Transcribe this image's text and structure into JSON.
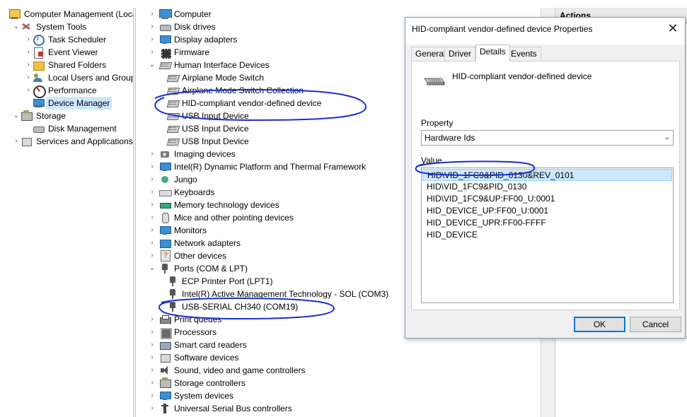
{
  "left_tree": [
    {
      "label": "Computer Management (Local",
      "level": 0,
      "chevron": "",
      "icon": "computer-management-icon",
      "selected": false
    },
    {
      "label": "System Tools",
      "level": 1,
      "chevron": "v",
      "icon": "tools-icon",
      "selected": false
    },
    {
      "label": "Task Scheduler",
      "level": 2,
      "chevron": ">",
      "icon": "clock-icon",
      "selected": false
    },
    {
      "label": "Event Viewer",
      "level": 2,
      "chevron": ">",
      "icon": "event-log-icon",
      "selected": false
    },
    {
      "label": "Shared Folders",
      "level": 2,
      "chevron": ">",
      "icon": "folder-icon",
      "selected": false
    },
    {
      "label": "Local Users and Groups",
      "level": 2,
      "chevron": ">",
      "icon": "users-icon",
      "selected": false
    },
    {
      "label": "Performance",
      "level": 2,
      "chevron": ">",
      "icon": "performance-icon",
      "selected": false
    },
    {
      "label": "Device Manager",
      "level": 2,
      "chevron": "",
      "icon": "device-manager-icon",
      "selected": true
    },
    {
      "label": "Storage",
      "level": 1,
      "chevron": "v",
      "icon": "storage-icon",
      "selected": false
    },
    {
      "label": "Disk Management",
      "level": 2,
      "chevron": "",
      "icon": "disk-icon",
      "selected": false
    },
    {
      "label": "Services and Applications",
      "level": 1,
      "chevron": ">",
      "icon": "services-icon",
      "selected": false
    }
  ],
  "device_tree": [
    {
      "label": "Computer",
      "level": 0,
      "chevron": ">",
      "icon": "computer-icon"
    },
    {
      "label": "Disk drives",
      "level": 0,
      "chevron": ">",
      "icon": "disk-icon"
    },
    {
      "label": "Display adapters",
      "level": 0,
      "chevron": ">",
      "icon": "monitor-icon"
    },
    {
      "label": "Firmware",
      "level": 0,
      "chevron": ">",
      "icon": "chip-icon"
    },
    {
      "label": "Human Interface Devices",
      "level": 0,
      "chevron": "v",
      "icon": "hid-icon"
    },
    {
      "label": "Airplane Mode Switch",
      "level": 1,
      "chevron": "",
      "icon": "hid-icon"
    },
    {
      "label": "Airplane Mode Switch Collection",
      "level": 1,
      "chevron": "",
      "icon": "hid-icon"
    },
    {
      "label": "HID-compliant vendor-defined device",
      "level": 1,
      "chevron": "",
      "icon": "hid-icon"
    },
    {
      "label": "USB Input Device",
      "level": 1,
      "chevron": "",
      "icon": "hid-icon"
    },
    {
      "label": "USB Input Device",
      "level": 1,
      "chevron": "",
      "icon": "hid-icon"
    },
    {
      "label": "USB Input Device",
      "level": 1,
      "chevron": "",
      "icon": "hid-icon"
    },
    {
      "label": "Imaging devices",
      "level": 0,
      "chevron": ">",
      "icon": "camera-icon"
    },
    {
      "label": "Intel(R) Dynamic Platform and Thermal Framework",
      "level": 0,
      "chevron": ">",
      "icon": "monitor-icon"
    },
    {
      "label": "Jungo",
      "level": 0,
      "chevron": ">",
      "icon": "jungo-icon"
    },
    {
      "label": "Keyboards",
      "level": 0,
      "chevron": ">",
      "icon": "keyboard-icon"
    },
    {
      "label": "Memory technology devices",
      "level": 0,
      "chevron": ">",
      "icon": "memory-icon"
    },
    {
      "label": "Mice and other pointing devices",
      "level": 0,
      "chevron": ">",
      "icon": "mouse-icon"
    },
    {
      "label": "Monitors",
      "level": 0,
      "chevron": ">",
      "icon": "monitor-icon"
    },
    {
      "label": "Network adapters",
      "level": 0,
      "chevron": ">",
      "icon": "network-icon"
    },
    {
      "label": "Other devices",
      "level": 0,
      "chevron": ">",
      "icon": "other-device-icon"
    },
    {
      "label": "Ports (COM & LPT)",
      "level": 0,
      "chevron": "v",
      "icon": "port-icon"
    },
    {
      "label": "ECP Printer Port (LPT1)",
      "level": 1,
      "chevron": "",
      "icon": "port-icon"
    },
    {
      "label": "Intel(R) Active Management Technology - SOL (COM3)",
      "level": 1,
      "chevron": "",
      "icon": "port-icon"
    },
    {
      "label": "USB-SERIAL CH340 (COM19)",
      "level": 1,
      "chevron": "",
      "icon": "port-icon"
    },
    {
      "label": "Print queues",
      "level": 0,
      "chevron": ">",
      "icon": "printer-icon"
    },
    {
      "label": "Processors",
      "level": 0,
      "chevron": ">",
      "icon": "cpu-icon"
    },
    {
      "label": "Smart card readers",
      "level": 0,
      "chevron": ">",
      "icon": "card-reader-icon"
    },
    {
      "label": "Software devices",
      "level": 0,
      "chevron": ">",
      "icon": "software-device-icon"
    },
    {
      "label": "Sound, video and game controllers",
      "level": 0,
      "chevron": ">",
      "icon": "sound-icon"
    },
    {
      "label": "Storage controllers",
      "level": 0,
      "chevron": ">",
      "icon": "storage-controller-icon"
    },
    {
      "label": "System devices",
      "level": 0,
      "chevron": ">",
      "icon": "monitor-icon"
    },
    {
      "label": "Universal Serial Bus controllers",
      "level": 0,
      "chevron": ">",
      "icon": "usb-icon"
    }
  ],
  "actions_pane": {
    "title": "Actions"
  },
  "dialog": {
    "title": "HID-compliant vendor-defined device Properties",
    "close_glyph": "✕",
    "tabs": [
      {
        "label": "General",
        "active": false
      },
      {
        "label": "Driver",
        "active": false
      },
      {
        "label": "Details",
        "active": true
      },
      {
        "label": "Events",
        "active": false
      }
    ],
    "device_name": "HID-compliant vendor-defined device",
    "property_label": "Property",
    "property_value": "Hardware Ids",
    "value_label": "Value",
    "values": [
      "HID\\VID_1FC9&PID_0130&REV_0101",
      "HID\\VID_1FC9&PID_0130",
      "HID\\VID_1FC9&UP:FF00_U:0001",
      "HID_DEVICE_UP:FF00_U:0001",
      "HID_DEVICE_UPR:FF00-FFFF",
      "HID_DEVICE"
    ],
    "selected_value_index": 0,
    "ok_label": "OK",
    "cancel_label": "Cancel"
  },
  "colors": {
    "selection": "#cce8ff",
    "annotation_ink": "#1a2fd1",
    "default_button_border": "#0078d7"
  }
}
